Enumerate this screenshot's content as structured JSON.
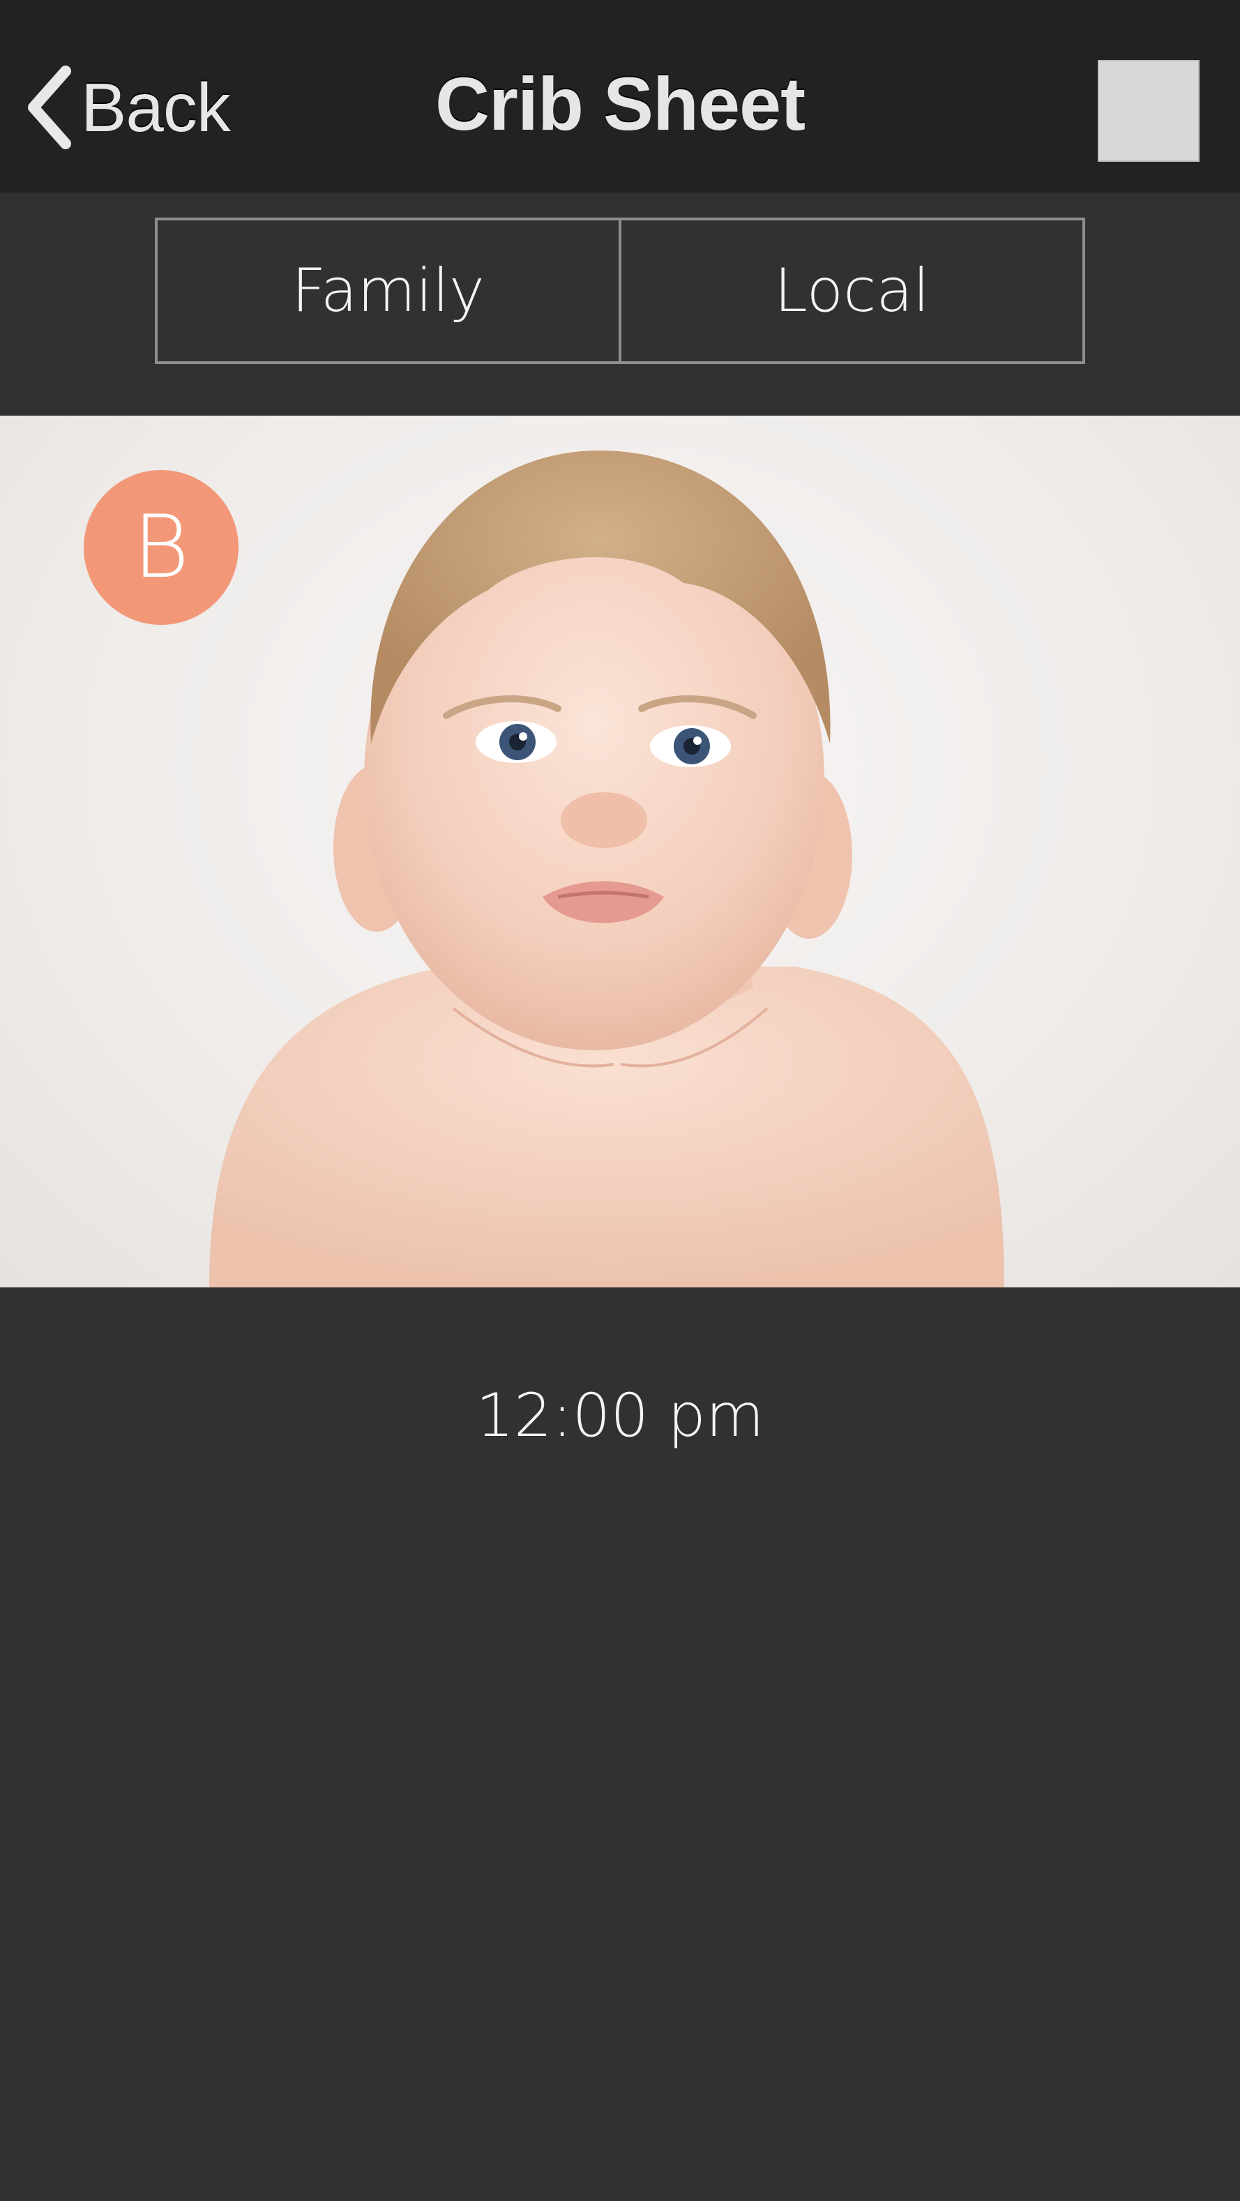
{
  "navbar": {
    "back_label": "Back",
    "title": "Crib Sheet",
    "icons": {
      "back": "chevron-left-icon",
      "action": "square-button"
    }
  },
  "tabs": [
    {
      "label": "Family"
    },
    {
      "label": "Local"
    }
  ],
  "photo": {
    "badge_letter": "B"
  },
  "time": "12:00 pm",
  "colors": {
    "navbar": "#222222",
    "background": "#323131",
    "badge": "#f29878",
    "segment_border": "#8e8e8e"
  }
}
